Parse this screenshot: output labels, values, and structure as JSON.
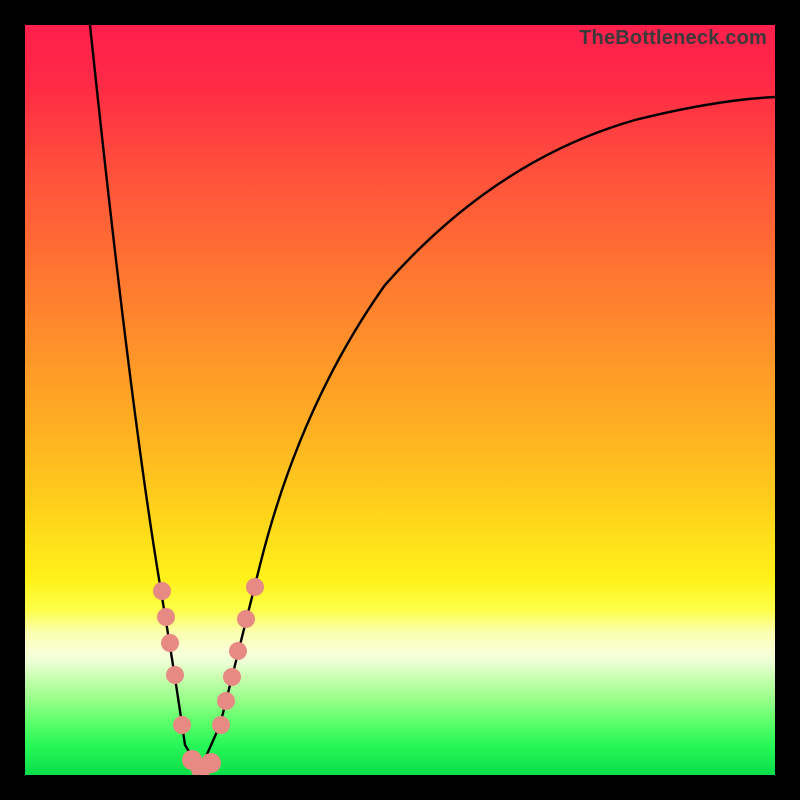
{
  "watermark": "TheBottleneck.com",
  "colors": {
    "curve": "#000000",
    "dots": "#e78a83",
    "gradient_top": "#ff1f4c",
    "gradient_bottom": "#0adf49"
  },
  "chart_data": {
    "type": "line",
    "title": "",
    "xlabel": "",
    "ylabel": "",
    "xlim": [
      0,
      100
    ],
    "ylim": [
      0,
      100
    ],
    "grid": false,
    "legend": false,
    "note": "No axes, tick labels, or numeric annotations are rendered in the image; x and y values below are estimated in percent-of-plot coordinates (0 = left/bottom, 100 = right/top) read from pixel positions.",
    "series": [
      {
        "name": "bottleneck-curve",
        "x": [
          8.7,
          14.5,
          17.3,
          19.3,
          21.3,
          23.3,
          26.0,
          28.0,
          31.3,
          36.7,
          48.0,
          62.7,
          81.3,
          100.0
        ],
        "y": [
          100.0,
          49.3,
          25.3,
          13.3,
          4.0,
          0.7,
          6.7,
          14.7,
          28.0,
          49.3,
          65.3,
          82.0,
          87.3,
          90.4
        ]
      },
      {
        "name": "highlighted-points",
        "marker": "circle",
        "color": "#e78a83",
        "x": [
          18.3,
          18.8,
          19.3,
          20.0,
          20.9,
          22.3,
          23.5,
          24.8,
          26.1,
          26.8,
          27.6,
          28.4,
          29.5,
          30.7
        ],
        "y": [
          24.5,
          21.1,
          17.6,
          13.3,
          6.7,
          2.0,
          0.8,
          1.6,
          6.7,
          9.9,
          13.1,
          16.5,
          20.8,
          25.1
        ]
      }
    ]
  }
}
